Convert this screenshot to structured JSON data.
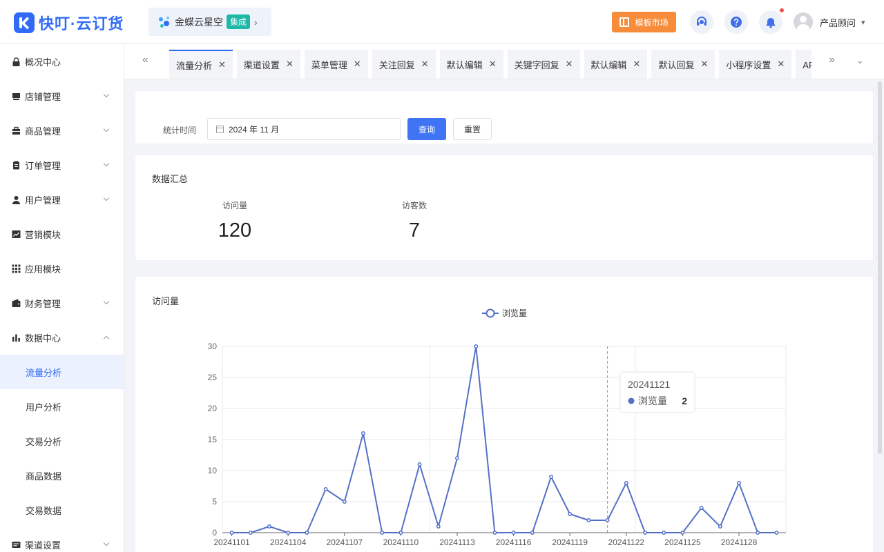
{
  "header": {
    "logo_text": "快叮·云订货",
    "kingdee": {
      "label": "金蝶云星空",
      "badge": "集成",
      "chevron": "›"
    },
    "template_market": "模板市场",
    "user_name": "产品顾问",
    "user_chevron": "⌄"
  },
  "sidebar": {
    "items": [
      {
        "label": "概况中心",
        "icon": "lock-icon"
      },
      {
        "label": "店铺管理",
        "icon": "store-icon"
      },
      {
        "label": "商品管理",
        "icon": "box-icon"
      },
      {
        "label": "订单管理",
        "icon": "clipboard-icon"
      },
      {
        "label": "用户管理",
        "icon": "user-icon"
      },
      {
        "label": "营销模块",
        "icon": "trend-icon"
      },
      {
        "label": "应用模块",
        "icon": "grid-icon"
      },
      {
        "label": "财务管理",
        "icon": "wallet-icon"
      },
      {
        "label": "数据中心",
        "icon": "bar-chart-icon"
      }
    ],
    "sub_items": [
      {
        "label": "流量分析"
      },
      {
        "label": "用户分析"
      },
      {
        "label": "交易分析"
      },
      {
        "label": "商品数据"
      },
      {
        "label": "交易数据"
      }
    ],
    "bottom_item": {
      "label": "渠道设置"
    }
  },
  "tabs": [
    {
      "label": "流量分析"
    },
    {
      "label": "渠道设置"
    },
    {
      "label": "菜单管理"
    },
    {
      "label": "关注回复"
    },
    {
      "label": "默认编辑"
    },
    {
      "label": "关键字回复"
    },
    {
      "label": "默认编辑"
    },
    {
      "label": "默认回复"
    },
    {
      "label": "小程序设置"
    },
    {
      "label": "APP首页"
    }
  ],
  "filter": {
    "label": "统计时间",
    "date_value": "2024 年 11 月",
    "query_button": "查询",
    "reset_button": "重置"
  },
  "summary": {
    "title": "数据汇总",
    "visits_label": "访问量",
    "visits_value": "120",
    "visitors_label": "访客数",
    "visitors_value": "7"
  },
  "chart_section": {
    "title": "访问量"
  },
  "chart_data": {
    "type": "line",
    "legend": "浏览量",
    "series": [
      {
        "name": "浏览量",
        "color": "#5470c6",
        "values": [
          0,
          0,
          1,
          0,
          0,
          7,
          5,
          16,
          0,
          0,
          11,
          1,
          12,
          30,
          0,
          0,
          0,
          9,
          3,
          2,
          2,
          8,
          0,
          0,
          0,
          4,
          1,
          8,
          0,
          0
        ]
      }
    ],
    "categories": [
      "20241101",
      "20241102",
      "20241103",
      "20241104",
      "20241105",
      "20241106",
      "20241107",
      "20241108",
      "20241109",
      "20241110",
      "20241111",
      "20241112",
      "20241113",
      "20241114",
      "20241115",
      "20241116",
      "20241117",
      "20241118",
      "20241119",
      "20241120",
      "20241121",
      "20241122",
      "20241123",
      "20241124",
      "20241125",
      "20241126",
      "20241127",
      "20241128",
      "20241129",
      "20241130"
    ],
    "x_tick_labels": [
      "20241101",
      "20241104",
      "20241107",
      "20241110",
      "20241113",
      "20241116",
      "20241119",
      "20241122",
      "20241125",
      "20241128"
    ],
    "y_ticks": [
      0,
      5,
      10,
      15,
      20,
      25,
      30
    ],
    "ylim": [
      0,
      30
    ],
    "tooltip": {
      "date": "20241121",
      "series": "浏览量",
      "value": "2"
    }
  }
}
